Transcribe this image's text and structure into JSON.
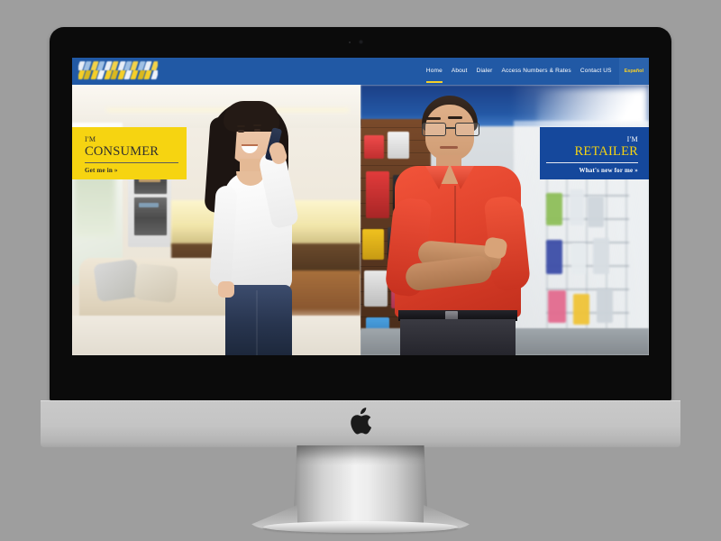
{
  "device": {
    "brand_logo": "apple-logo",
    "webcam": "webcam-dot"
  },
  "site": {
    "header": {
      "logo_alt": "company-logo",
      "nav": [
        {
          "label": "Home",
          "active": true
        },
        {
          "label": "About",
          "active": false
        },
        {
          "label": "Dialer",
          "active": false
        },
        {
          "label": "Access Numbers & Rates",
          "active": false
        },
        {
          "label": "Contact US",
          "active": false
        }
      ],
      "language_button": "Español"
    },
    "hero": {
      "consumer": {
        "kicker": "I'M",
        "headline": "CONSUMER",
        "cta": "Get me in »",
        "panel_color": "#f6d411",
        "scene": "woman-on-phone-in-kitchen"
      },
      "retailer": {
        "kicker": "I'M",
        "headline": "RETAILER",
        "cta": "What's new for me »",
        "panel_color": "#15489c",
        "headline_color": "#f6d411",
        "scene": "retailer-in-electronics-store"
      }
    }
  },
  "colors": {
    "header_blue": "#2159a5",
    "accent_yellow": "#f6d411",
    "panel_blue": "#15489c",
    "page_background": "#9e9e9e",
    "bezel_black": "#0b0b0b",
    "chin_silver": "#c4c4c4"
  }
}
